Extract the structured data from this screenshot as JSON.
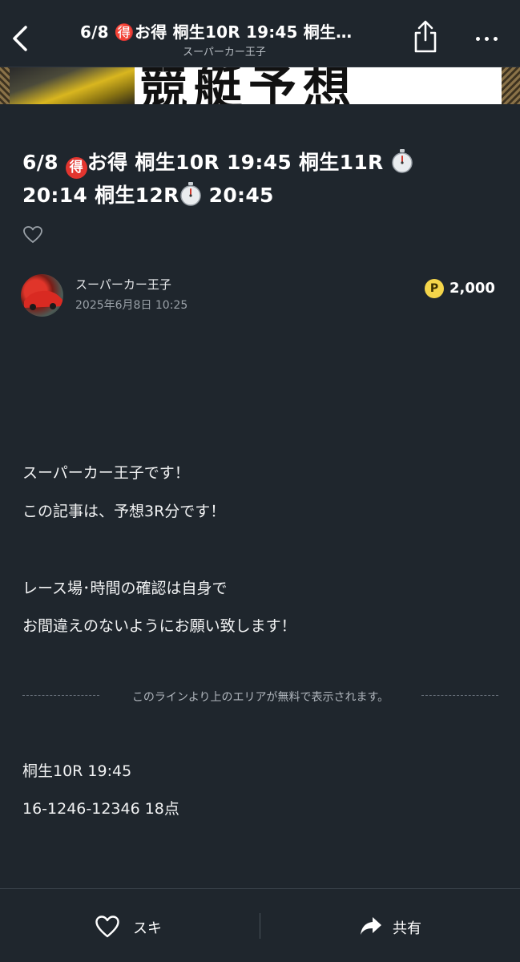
{
  "nav": {
    "title": "6/8 🉐お得 桐生10R 19:45 桐生…",
    "subtitle": "スーパーカー王子",
    "icons": {
      "back": "chevron-left-icon",
      "share": "share-icon",
      "more": "more-icon"
    }
  },
  "hero": {
    "text": "競艇予想"
  },
  "article": {
    "title_parts": {
      "p1": "6/8 ",
      "toku": "得",
      "p2": "お得 桐生10R 19:45 桐生11R ",
      "p3": "20:14 桐生12R",
      "p4": " 20:45"
    }
  },
  "author": {
    "name": "スーパーカー王子",
    "date": "2025年6月8日 10:25",
    "price_symbol": "P",
    "price": "2,000"
  },
  "body": {
    "line1": "スーパーカー王子です！",
    "line2": "この記事は、予想3R分です！",
    "line3": "レース場･時間の確認は自身で",
    "line4": "お間違えのないようにお願い致します！",
    "paywall": "このラインより上のエリアが無料で表示されます。",
    "line5": "桐生10R 19:45",
    "line6": "16-1246-12346 18点"
  },
  "bottom": {
    "like_label": "スキ",
    "share_label": "共有"
  },
  "colors": {
    "background": "#1f262d",
    "toku_badge": "#e2352f",
    "price_coin": "#f4d54a"
  }
}
